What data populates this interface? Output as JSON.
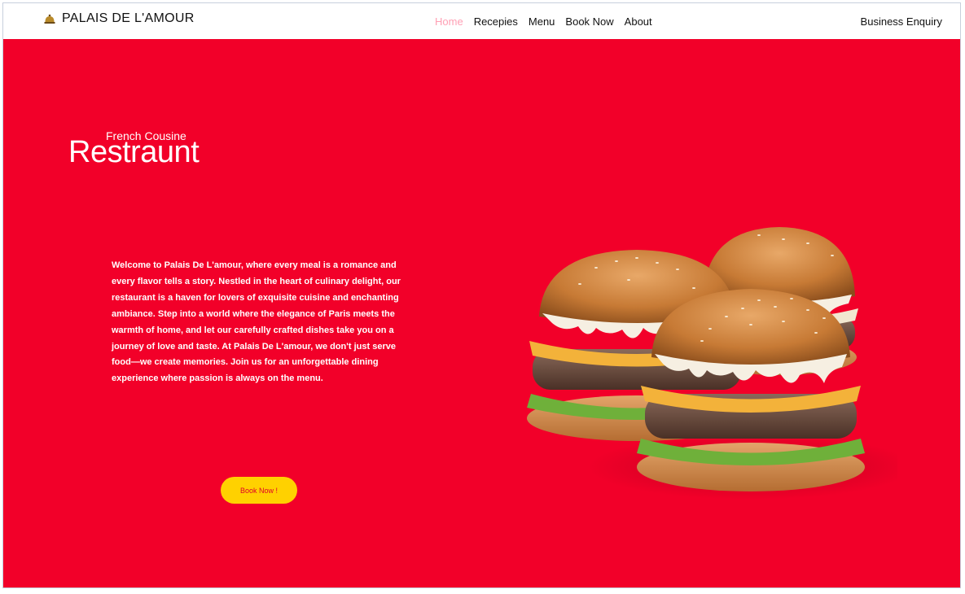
{
  "nav": {
    "brand": "PALAIS DE L'AMOUR",
    "links": [
      "Home",
      "Recepies",
      "Menu",
      "Book Now",
      "About"
    ],
    "active_link": "Home",
    "enquiry": "Business Enquiry"
  },
  "hero": {
    "subtitle": "French Cousine",
    "title": "Restraunt",
    "description": "Welcome to Palais De L'amour, where every meal is a romance and every flavor tells a story. Nestled in the heart of culinary delight, our restaurant is a haven for lovers of exquisite cuisine and enchanting ambiance. Step into a world where the elegance of Paris meets the warmth of home, and let our carefully crafted dishes take you on a journey of love and taste. At Palais De L'amour, we don't just serve food—we create memories. Join us for an unforgettable dining experience where passion is always on the menu.",
    "cta": "Book Now !",
    "image": "burgers-image"
  },
  "colors": {
    "hero_background": "#f20029",
    "cta_background": "#ffd100",
    "active_link": "#ff9fb4"
  }
}
